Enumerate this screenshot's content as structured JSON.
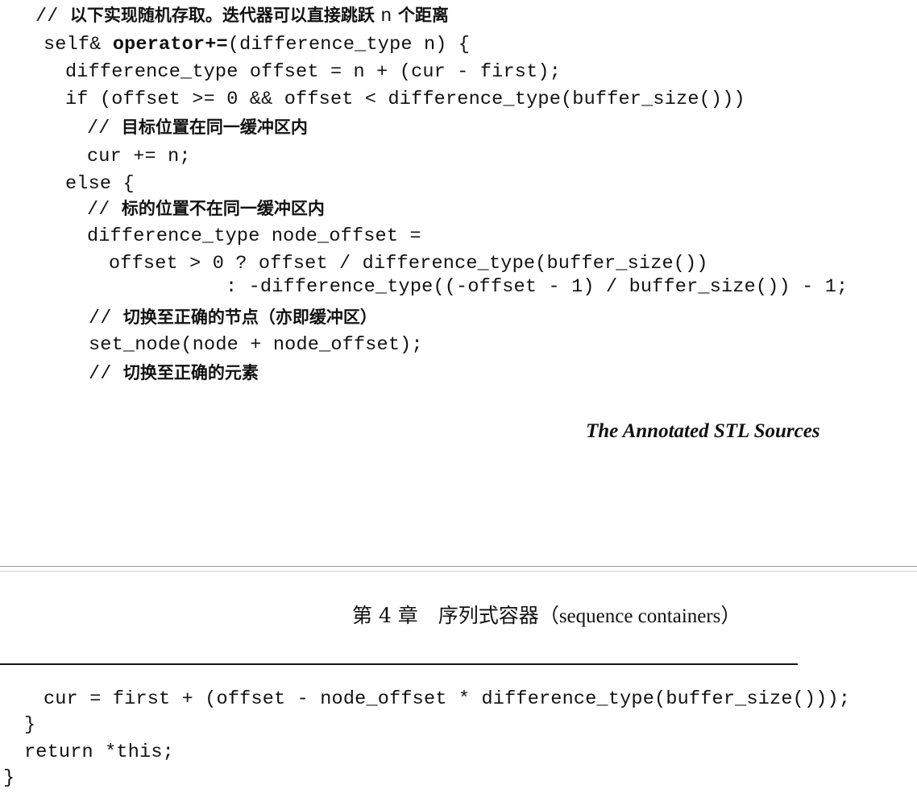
{
  "upper_page": {
    "lines": [
      {
        "code_before": "",
        "comment_mark": "// ",
        "comment": "以下实现随机存取。迭代器可以直接跳跃 ",
        "comment_mono": "n",
        "comment_after": " 个距离"
      },
      {
        "code_before": "self& ",
        "keyword": "operator+=",
        "code_after": "(difference_type n) {"
      },
      {
        "code_before": "difference_type offset = n + (cur - first);"
      },
      {
        "code_before": "if (offset >= 0 && offset < difference_type(buffer_size()))"
      },
      {
        "code_before": "",
        "comment_mark": "// ",
        "comment": "目标位置在同一缓冲区内"
      },
      {
        "code_before": "cur += n;"
      },
      {
        "code_before": "else {"
      },
      {
        "code_before": "",
        "comment_mark": "// ",
        "comment": "标的位置不在同一缓冲区内"
      },
      {
        "code_before": "difference_type node_offset ="
      },
      {
        "code_before": "offset > 0 ? offset / difference_type(buffer_size())"
      },
      {
        "code_before": ": -difference_type((-offset - 1) / buffer_size()) - 1;"
      },
      {
        "code_before": "",
        "comment_mark": "// ",
        "comment": "切换至正确的节点（亦即缓冲区）"
      },
      {
        "code_before": "set_node(node + node_offset);"
      },
      {
        "code_before": "",
        "comment_mark": "// ",
        "comment": "切换至正确的元素"
      }
    ],
    "footer_title": "The Annotated STL Sources"
  },
  "lower_page": {
    "chapter_label": "第 4 章　序列式容器",
    "chapter_sub": "（sequence containers）",
    "lines": [
      {
        "code_before": "cur = first + (offset - node_offset * difference_type(buffer_size()));"
      },
      {
        "code_before": "}"
      },
      {
        "code_before": "return *this;"
      },
      {
        "code_before": "}"
      }
    ]
  }
}
